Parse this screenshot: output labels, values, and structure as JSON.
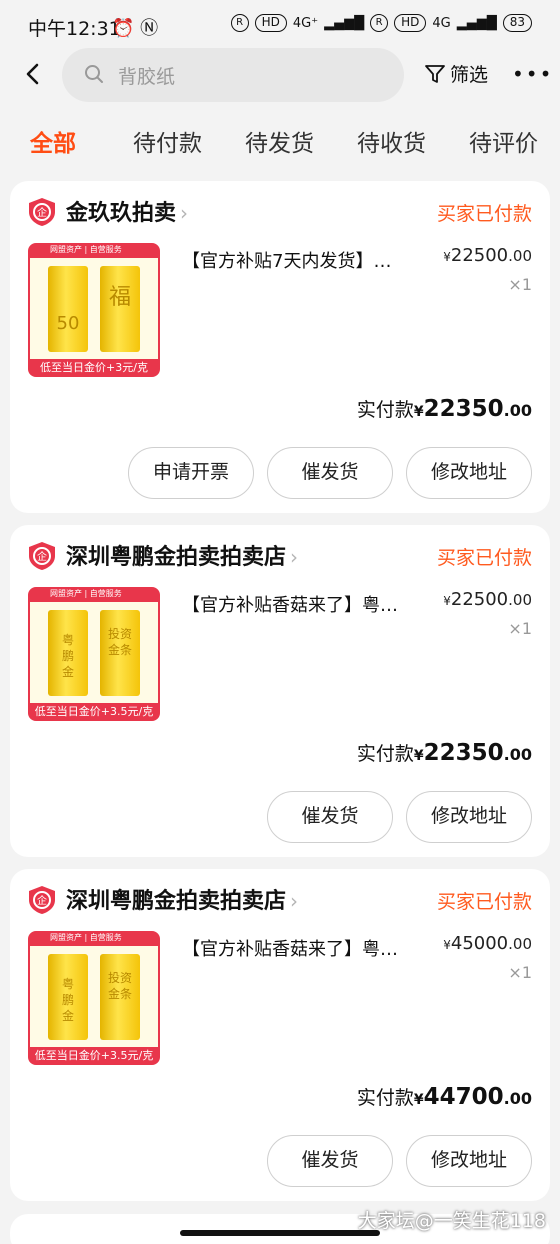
{
  "status_bar": {
    "time": "中午12:31",
    "icons_left": "⏰ Ⓝ",
    "net1": "4G⁺",
    "net2": "4G",
    "battery": "83"
  },
  "search": {
    "placeholder": "背胶纸",
    "filter_label": "筛选",
    "more": "•••"
  },
  "tabs": [
    {
      "label": "全部",
      "active": true
    },
    {
      "label": "待付款"
    },
    {
      "label": "待发货"
    },
    {
      "label": "待收货"
    },
    {
      "label": "待评价"
    }
  ],
  "orders": [
    {
      "shop": "金玖玖拍卖",
      "status": "买家已付款",
      "title": "【官方补贴7天内发货】…",
      "price_int": "22500",
      "price_dec": ".00",
      "qty": "×1",
      "paid_label": "实付款",
      "paid_int": "22350",
      "paid_dec": ".00",
      "thumb_header": "网盟资产 | 自营服务",
      "thumb_bar1": "50",
      "thumb_bar2": "福",
      "thumb_footer": "低至当日金价+3元/克",
      "buttons": [
        "申请开票",
        "催发货",
        "修改地址"
      ]
    },
    {
      "shop": "深圳粤鹏金拍卖拍卖店",
      "status": "买家已付款",
      "title": "【官方补贴香菇来了】粤…",
      "price_int": "22500",
      "price_dec": ".00",
      "qty": "×1",
      "paid_label": "实付款",
      "paid_int": "22350",
      "paid_dec": ".00",
      "thumb_header": "网盟资产 | 自营服务",
      "thumb_bar1": "粤鹏金",
      "thumb_bar2": "投资金条",
      "thumb_footer": "低至当日金价+3.5元/克",
      "buttons": [
        "催发货",
        "修改地址"
      ]
    },
    {
      "shop": "深圳粤鹏金拍卖拍卖店",
      "status": "买家已付款",
      "title": "【官方补贴香菇来了】粤…",
      "price_int": "45000",
      "price_dec": ".00",
      "qty": "×1",
      "paid_label": "实付款",
      "paid_int": "44700",
      "paid_dec": ".00",
      "thumb_header": "网盟资产 | 自营服务",
      "thumb_bar1": "粤鹏金",
      "thumb_bar2": "投资金条",
      "thumb_footer": "低至当日金价+3.5元/克",
      "buttons": [
        "催发货",
        "修改地址"
      ]
    }
  ],
  "currency_symbol": "¥",
  "watermark": "大家坛@一笑生花118",
  "colors": {
    "accent": "#ff4d14",
    "status": "#ff5a1f",
    "logo_red": "#e8364b"
  }
}
